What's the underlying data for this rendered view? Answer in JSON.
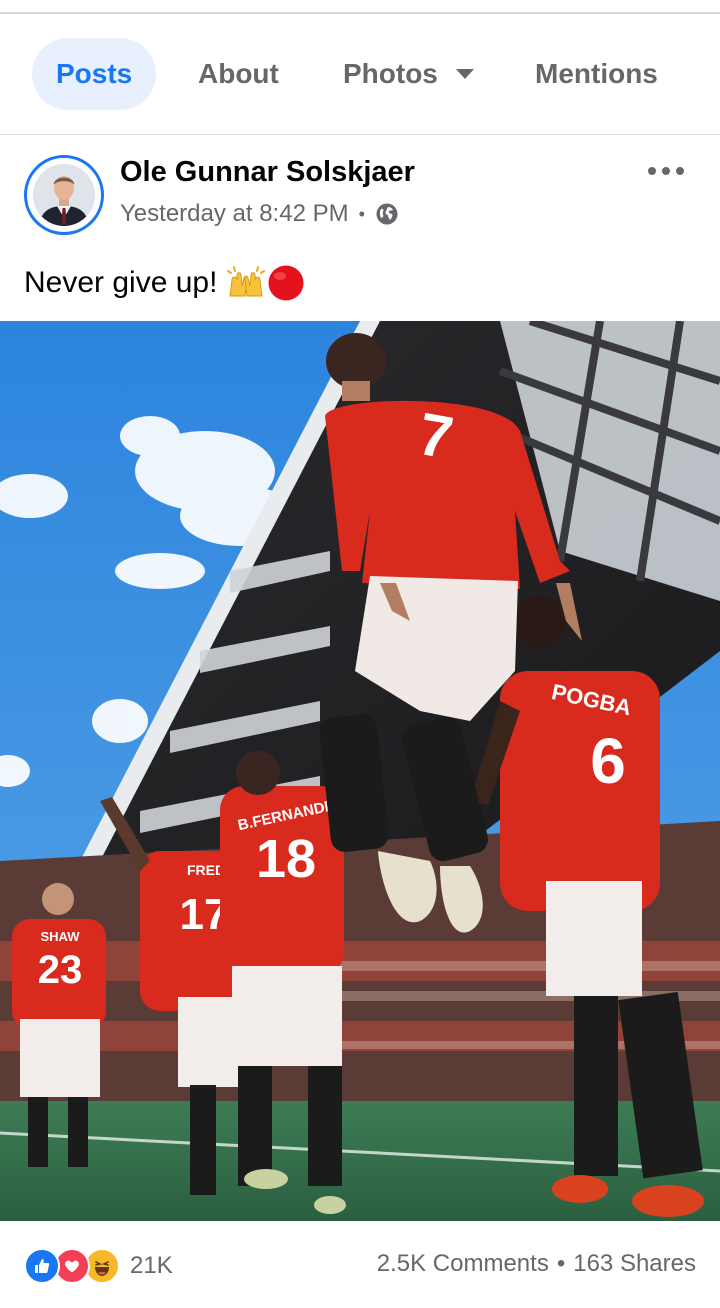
{
  "tabs": [
    {
      "label": "Posts",
      "active": true
    },
    {
      "label": "About"
    },
    {
      "label": "Photos"
    },
    {
      "label": "Mentions"
    }
  ],
  "post": {
    "author": "Ole Gunnar Solskjaer",
    "timestamp": "Yesterday at 8:42 PM",
    "separator": "•",
    "audience_icon": "globe-icon",
    "text": "Never give up!",
    "emojis": [
      "raising-hands-emoji",
      "red-circle-emoji"
    ]
  },
  "photo": {
    "jersey_numbers": [
      "7",
      "6",
      "18",
      "17",
      "23"
    ],
    "jersey_names": [
      "POGBA",
      "B.FERNANDES",
      "FRED",
      "SHAW"
    ]
  },
  "footer": {
    "reaction_icons": [
      "like-icon",
      "love-icon",
      "haha-icon"
    ],
    "reaction_count": "21K",
    "comments": "2.5K Comments",
    "shares": "163 Shares",
    "separator": "•"
  },
  "colors": {
    "accent": "#1877f2",
    "active_tab_bg": "#e7f0fc",
    "secondary_text": "#65676b",
    "jersey_red": "#d92a1e"
  }
}
